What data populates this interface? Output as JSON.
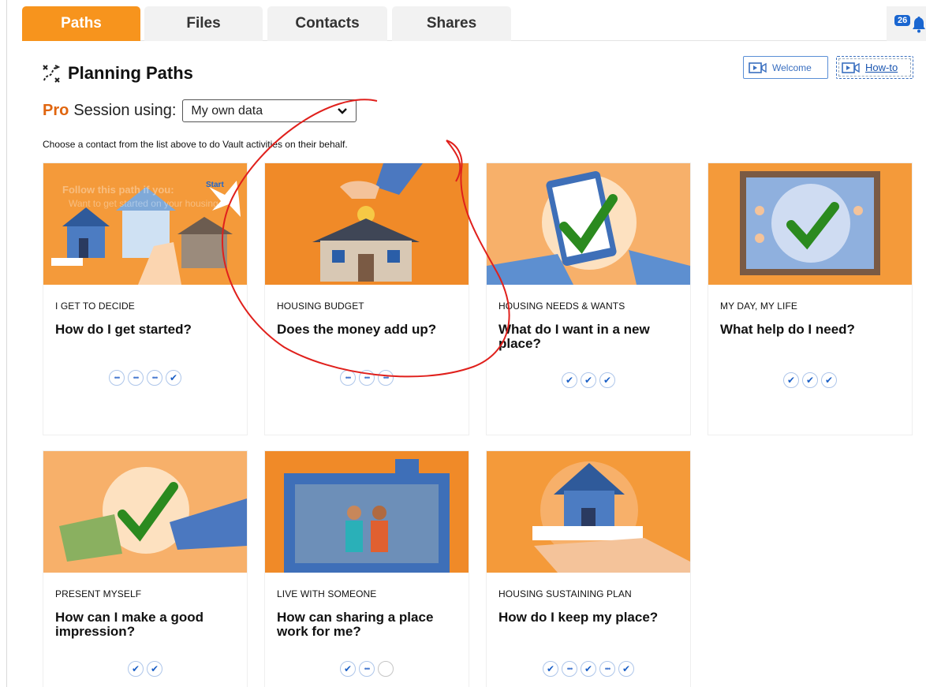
{
  "tabs": [
    "Paths",
    "Files",
    "Contacts",
    "Shares"
  ],
  "notification_count": "26",
  "header": {
    "title": "Planning Paths",
    "welcome_label": "Welcome",
    "howto_label": "How-to"
  },
  "session": {
    "pro_label": "Pro",
    "label": "Session using:",
    "selected": "My own data"
  },
  "hint": "Choose a contact from the list above to do Vault activities on their behalf.",
  "cards": [
    {
      "kicker": "I GET TO DECIDE",
      "question": "How do I get started?",
      "steps": [
        "dots",
        "dots",
        "dots",
        "check"
      ],
      "overlay": {
        "heading": "Follow this path if you:",
        "bullet": "Want to get started on your housing",
        "badge": "Start"
      }
    },
    {
      "kicker": "HOUSING BUDGET",
      "question": "Does the money add up?",
      "steps": [
        "dots",
        "dots",
        "dots"
      ]
    },
    {
      "kicker": "HOUSING NEEDS & WANTS",
      "question": "What do I want in a new place?",
      "steps": [
        "check",
        "check",
        "check"
      ]
    },
    {
      "kicker": "MY DAY, MY LIFE",
      "question": "What help do I need?",
      "steps": [
        "check",
        "check",
        "check"
      ]
    },
    {
      "kicker": "PRESENT MYSELF",
      "question": "How can I make a good impression?",
      "steps": [
        "check",
        "check"
      ]
    },
    {
      "kicker": "LIVE WITH SOMEONE",
      "question": "How can sharing a place work for me?",
      "steps": [
        "check",
        "dots",
        "empty"
      ]
    },
    {
      "kicker": "HOUSING SUSTAINING PLAN",
      "question": "How do I keep my place?",
      "steps": [
        "check",
        "dots",
        "check",
        "dots",
        "check"
      ]
    }
  ],
  "colors": {
    "accent": "#f7941d",
    "check_blue": "#1a5fc6",
    "annotation_red": "#e0201c"
  }
}
